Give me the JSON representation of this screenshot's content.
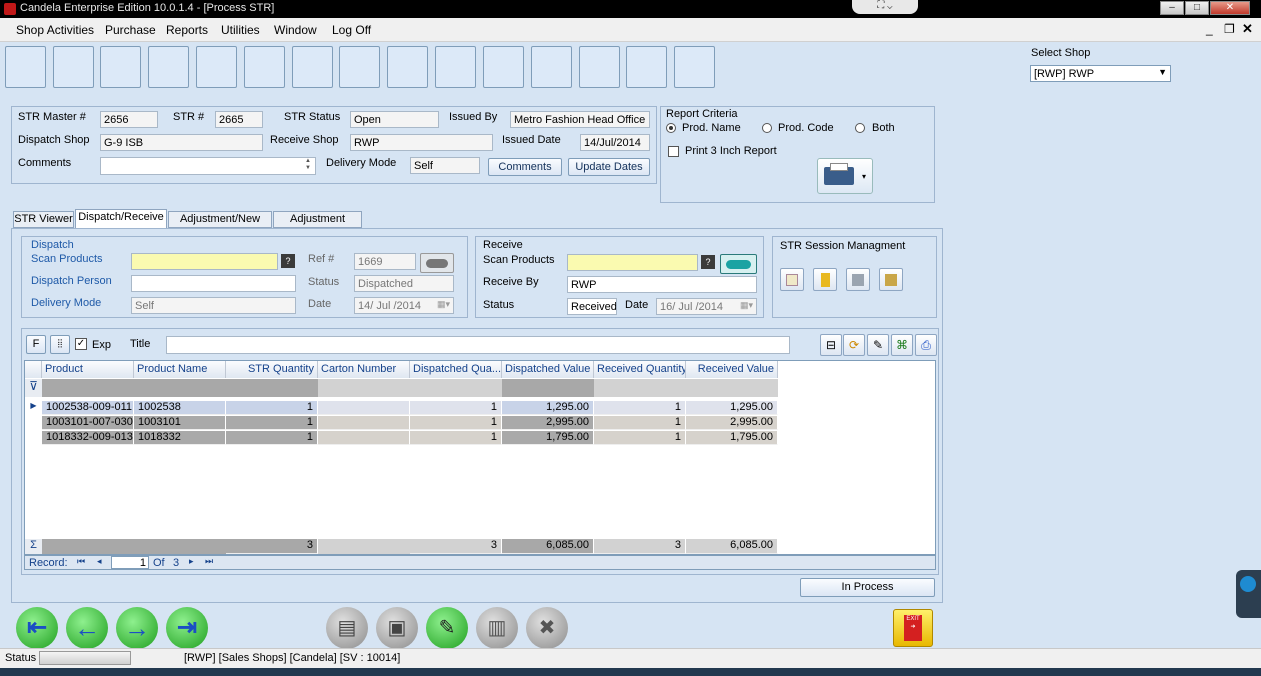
{
  "window": {
    "title": "Candela Enterprise Edition 10.0.1.4 - [Process STR]"
  },
  "menu": [
    "Shop Activities",
    "Purchase",
    "Reports",
    "Utilities",
    "Window",
    "Log Off"
  ],
  "shop": {
    "label": "Select Shop",
    "value": "[RWP]  RWP"
  },
  "header": {
    "str_master_label": "STR Master #",
    "str_master": "2656",
    "str_no_label": "STR #",
    "str_no": "2665",
    "status_label": "STR Status",
    "status": "Open",
    "issued_by_label": "Issued By",
    "issued_by": "Metro Fashion Head Office",
    "dispatch_shop_label": "Dispatch Shop",
    "dispatch_shop": "G-9 ISB",
    "receive_shop_label": "Receive Shop",
    "receive_shop": "RWP",
    "issued_date_label": "Issued Date",
    "issued_date": "14/Jul/2014",
    "comments_label": "Comments",
    "comments": "",
    "delivery_mode_label": "Delivery Mode",
    "delivery_mode": "Self",
    "comments_button": "Comments",
    "update_dates_button": "Update Dates"
  },
  "report": {
    "title": "Report Criteria",
    "opt_name": "Prod. Name",
    "opt_code": "Prod. Code",
    "opt_both": "Both",
    "print3": "Print 3 Inch Report"
  },
  "tabs": [
    "STR Viewer",
    "Dispatch/Receive",
    "Adjustment/New STR",
    "Adjustment Viewer"
  ],
  "dispatch": {
    "title": "Dispatch",
    "scan_label": "Scan Products",
    "scan": "",
    "person_label": "Dispatch Person",
    "person": "",
    "mode_label": "Delivery Mode",
    "mode": "Self",
    "ref_label": "Ref #",
    "ref": "1669",
    "status_label": "Status",
    "status": "Dispatched",
    "date_label": "Date",
    "date": "14/ Jul /2014"
  },
  "receive": {
    "title": "Receive",
    "scan_label": "Scan Products",
    "scan": "",
    "by_label": "Receive By",
    "by": "RWP",
    "status_label": "Status",
    "status": "Received",
    "date_label": "Date",
    "date": "16/ Jul /2014"
  },
  "session": {
    "title": "STR Session Managment"
  },
  "gridbar": {
    "f": "F",
    "exp": "Exp",
    "title_label": "Title",
    "title": ""
  },
  "columns": [
    "Product",
    "Product Name",
    "STR Quantity",
    "Carton Number",
    "Dispatched Qua...",
    "Dispatched Value",
    "Received Quantity",
    "Received Value"
  ],
  "rows": [
    [
      "1002538-009-011",
      "1002538",
      "1",
      "",
      "1",
      "1,295.00",
      "1",
      "1,295.00"
    ],
    [
      "1003101-007-030",
      "1003101",
      "1",
      "",
      "1",
      "2,995.00",
      "1",
      "2,995.00"
    ],
    [
      "1018332-009-013",
      "1018332",
      "1",
      "",
      "1",
      "1,795.00",
      "1",
      "1,795.00"
    ]
  ],
  "totals": {
    "str_qty": "3",
    "disp_qty": "3",
    "disp_val": "6,085.00",
    "rec_qty": "3",
    "rec_val": "6,085.00"
  },
  "nav": {
    "record_label": "Record:",
    "current": "1",
    "of_label": "Of",
    "total": "3"
  },
  "in_process_button": "In Process",
  "statusbar": {
    "label": "Status",
    "info": "[RWP]  [Sales Shops]  [Candela]  [SV : 10014]"
  },
  "colors": {
    "yellow_input": "#fafab0",
    "nav_green": "#2cb52c",
    "nav_blue": "#1b4fc4"
  }
}
